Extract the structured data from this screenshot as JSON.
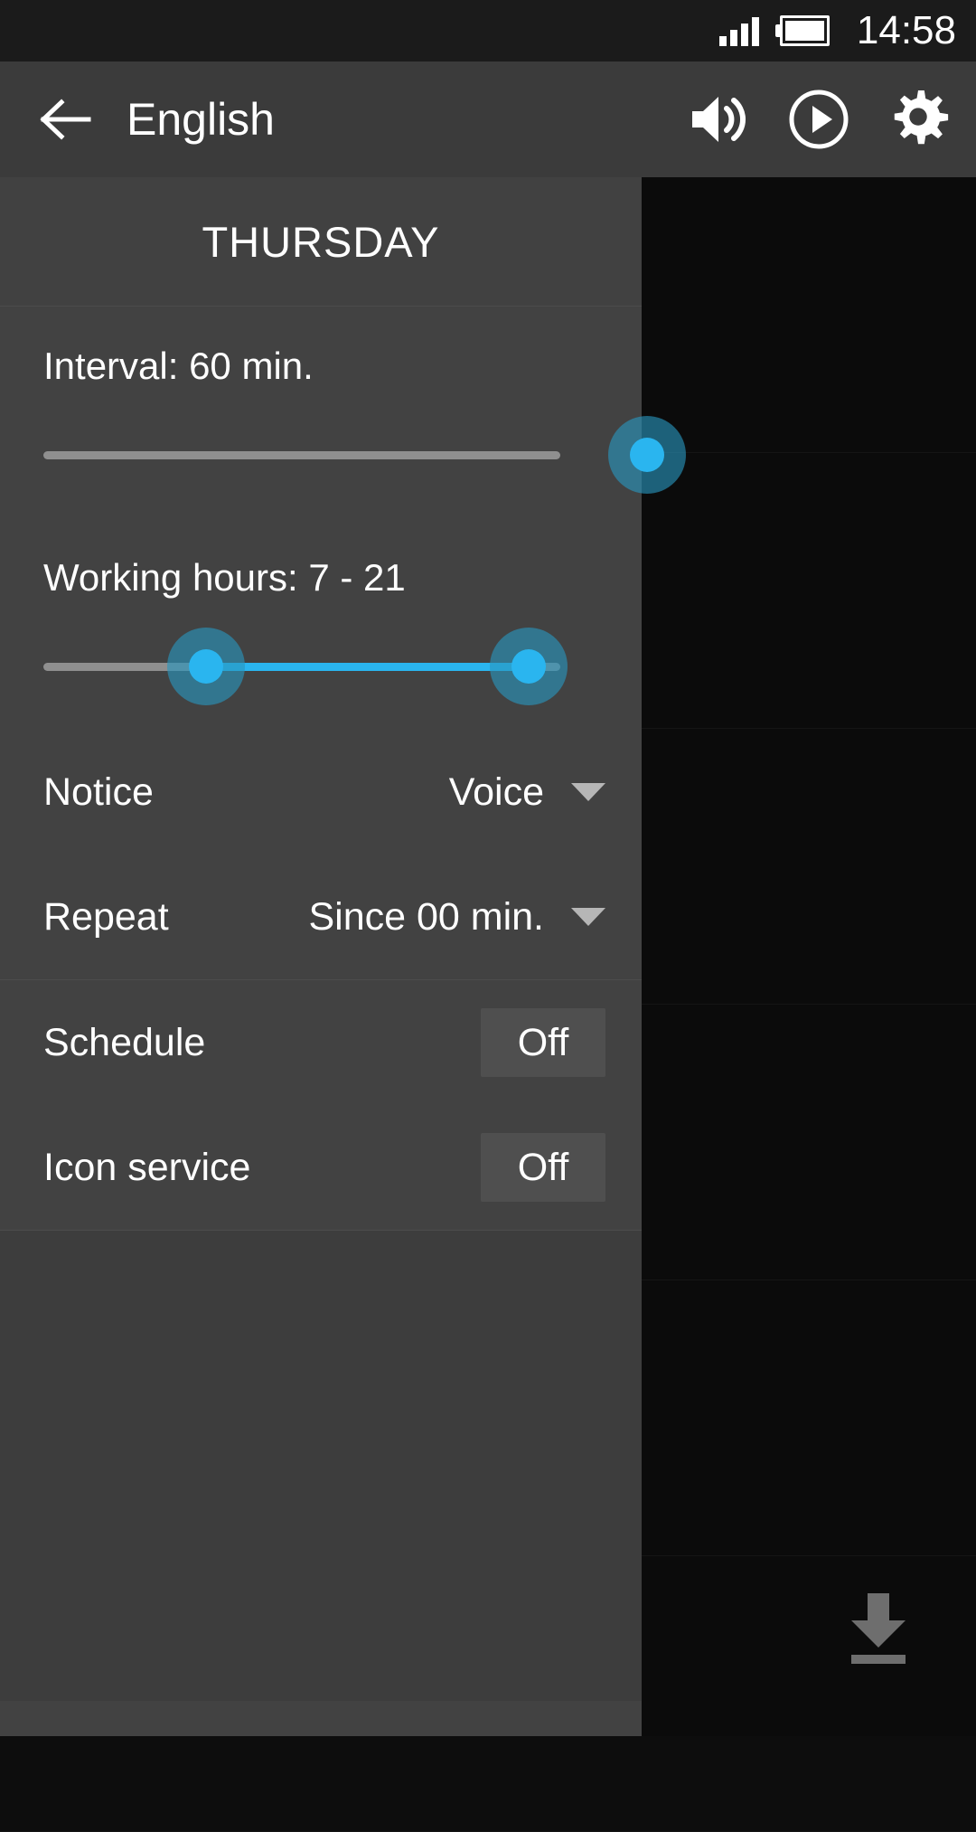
{
  "statusbar": {
    "time": "14:58",
    "signal_icon": "signal-bars-icon",
    "battery_icon": "battery-icon"
  },
  "appbar": {
    "back_icon": "back-arrow-icon",
    "title": "English",
    "actions": [
      {
        "name": "volume-icon",
        "label": "Volume"
      },
      {
        "name": "play-circle-icon",
        "label": "Play"
      },
      {
        "name": "gear-icon",
        "label": "Settings"
      }
    ]
  },
  "drawer": {
    "day_title": "THURSDAY",
    "interval": {
      "label": "Interval: 60 min.",
      "value": 60,
      "unit": "min.",
      "percent": 100
    },
    "working_hours": {
      "label": "Working hours: 7 - 21",
      "start": 7,
      "end": 21,
      "start_percent": 29,
      "end_percent": 87
    },
    "rows": [
      {
        "label": "Notice",
        "value": "Voice",
        "caret": "chevron-down-icon"
      },
      {
        "label": "Repeat",
        "value": "Since 00 min.",
        "caret": "chevron-down-icon"
      }
    ],
    "toggles": [
      {
        "label": "Schedule",
        "state": "Off"
      },
      {
        "label": "Icon service",
        "state": "Off"
      }
    ]
  },
  "background": {
    "download_icon": "download-icon"
  },
  "colors": {
    "accent": "#2ab5ef",
    "accent_halo": "#2996be",
    "panel": "#424242",
    "appbar": "#3b3b3b",
    "statusbar": "#1b1b1b",
    "backdrop": "#0b0b0b",
    "track": "#8f8f8f",
    "button": "#4f4f4f"
  }
}
